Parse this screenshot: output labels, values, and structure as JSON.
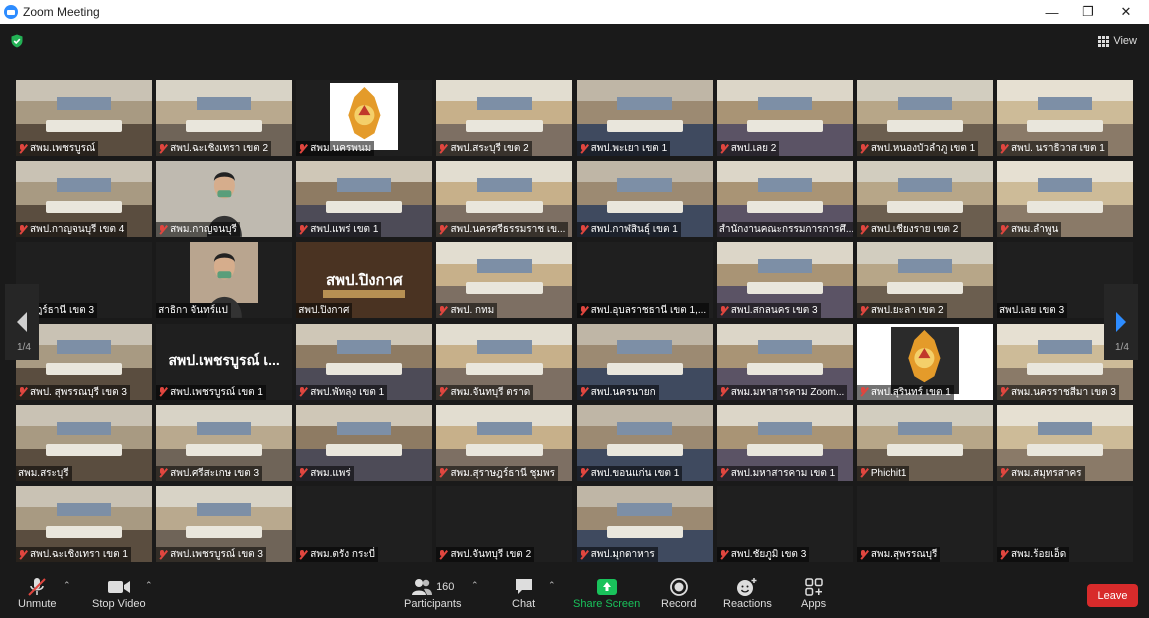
{
  "window": {
    "title": "Zoom Meeting",
    "controls": [
      "minimize",
      "maximize",
      "close"
    ]
  },
  "view_button": {
    "label": "View",
    "icon": "grid-icon"
  },
  "security_icon": "shield-check-icon",
  "pager": {
    "left_indicator": "1/4",
    "right_indicator": "1/4"
  },
  "tiles": [
    {
      "name": "สพม.เพชรบูรณ์",
      "muted": true,
      "scene": "room"
    },
    {
      "name": "สพป.ฉะเชิงเทรา เขต 2",
      "muted": true,
      "scene": "room"
    },
    {
      "name": "สพม.นครพนม",
      "muted": true,
      "scene": "seal"
    },
    {
      "name": "สพป.สระบุรี เขต 2",
      "muted": true,
      "scene": "room"
    },
    {
      "name": "สพป.พะเยา เขต 1",
      "muted": true,
      "scene": "room"
    },
    {
      "name": "สพป.เลย 2",
      "muted": true,
      "scene": "room"
    },
    {
      "name": "สพป.หนองบัวลำภู เขต 1",
      "muted": true,
      "scene": "room"
    },
    {
      "name": "สพป. นราธิวาส เขต 1",
      "muted": true,
      "scene": "room"
    },
    {
      "name": "สพป.กาญจนบุรี เขต 4",
      "muted": true,
      "scene": "room"
    },
    {
      "name": "สพม.กาญจนบุรี",
      "muted": true,
      "scene": "person"
    },
    {
      "name": "สพป.แพร่ เขต 1",
      "muted": true,
      "scene": "room"
    },
    {
      "name": "สพป.นครศรีธรรมราช เข...",
      "muted": true,
      "scene": "room"
    },
    {
      "name": "สพป.กาฬสินธุ์ เขต 1",
      "muted": true,
      "scene": "room"
    },
    {
      "name": "สำนักงานคณะกรรมการการศึ...",
      "muted": false,
      "scene": "room"
    },
    {
      "name": "สพป.เชียงราย เขต 2",
      "muted": true,
      "scene": "room"
    },
    {
      "name": "สพม.ลำพูน",
      "muted": true,
      "scene": "room"
    },
    {
      "name": "ราษฎร์ธานี เขต 3",
      "muted": false,
      "scene": "dark"
    },
    {
      "name": "สาธิกา จันทร์แป",
      "muted": false,
      "scene": "person"
    },
    {
      "name": "สพป.ปิงกาศ",
      "muted": false,
      "scene": "sign",
      "active": true,
      "sign_text": "สพป.ปิงกาศ"
    },
    {
      "name": "สพป. กทม",
      "muted": true,
      "scene": "room"
    },
    {
      "name": "สพป.อุบลราชธานี เขต 1,...",
      "muted": true,
      "scene": "dark"
    },
    {
      "name": "สพป.สกลนคร เขต 3",
      "muted": true,
      "scene": "room"
    },
    {
      "name": "สพป.ยะลา เขต 2",
      "muted": true,
      "scene": "room"
    },
    {
      "name": "สพป.เลย เขต 3",
      "muted": false,
      "scene": "dark"
    },
    {
      "name": "สพป. สุพรรณบุรี เขต 3",
      "muted": true,
      "scene": "room"
    },
    {
      "name": "สพป.เพชรบูรณ์ เขต 1",
      "muted": true,
      "scene": "textonly",
      "big_text": "สพป.เพชรบูรณ์ เ..."
    },
    {
      "name": "สพป.พัทลุง เขต 1",
      "muted": true,
      "scene": "room"
    },
    {
      "name": "สพม.จันทบุรี ตราด",
      "muted": true,
      "scene": "room"
    },
    {
      "name": "สพป.นครนายก",
      "muted": true,
      "scene": "room"
    },
    {
      "name": "สพม.มหาสารคาม Zoom...",
      "muted": true,
      "scene": "room"
    },
    {
      "name": "สพป.สุรินทร์ เขต 1",
      "muted": true,
      "scene": "seal"
    },
    {
      "name": "สพม.นครราชสีมา เขต 3",
      "muted": true,
      "scene": "room"
    },
    {
      "name": "สพม.สระบุรี",
      "muted": false,
      "scene": "room"
    },
    {
      "name": "สพป.ศรีสะเกษ เขต 3",
      "muted": true,
      "scene": "room"
    },
    {
      "name": "สพม.แพร่",
      "muted": true,
      "scene": "room"
    },
    {
      "name": "สพม.สุราษฎร์ธานี ชุมพร",
      "muted": true,
      "scene": "room"
    },
    {
      "name": "สพป.ขอนแก่น เขต 1",
      "muted": true,
      "scene": "room"
    },
    {
      "name": "สพป.มหาสารคาม เขต 1",
      "muted": true,
      "scene": "room"
    },
    {
      "name": "Phichit1",
      "muted": true,
      "scene": "room"
    },
    {
      "name": "สพม.สมุทรสาคร",
      "muted": true,
      "scene": "room"
    },
    {
      "name": "สพป.ฉะเชิงเทรา เขต 1",
      "muted": true,
      "scene": "room"
    },
    {
      "name": "สพป.เพชรบูรณ์ เขต 3",
      "muted": true,
      "scene": "room"
    },
    {
      "name": "สพม.ตรัง กระบี่",
      "muted": true,
      "scene": "dark"
    },
    {
      "name": "สพป.จันทบุรี เขต 2",
      "muted": true,
      "scene": "dark"
    },
    {
      "name": "สพป.มุกดาหาร",
      "muted": true,
      "scene": "room"
    },
    {
      "name": "สพป.ชัยภูมิ เขต 3",
      "muted": true,
      "scene": "dark"
    },
    {
      "name": "สพม.สุพรรณบุรี",
      "muted": true,
      "scene": "dark"
    },
    {
      "name": "สพม.ร้อยเอ็ด",
      "muted": true,
      "scene": "dark"
    }
  ],
  "toolbar": {
    "unmute": {
      "label": "Unmute",
      "icon": "mic-muted-icon"
    },
    "stop_video": {
      "label": "Stop Video",
      "icon": "video-camera-icon"
    },
    "participants": {
      "label": "Participants",
      "count": "160",
      "icon": "participants-icon"
    },
    "chat": {
      "label": "Chat",
      "icon": "chat-icon"
    },
    "share_screen": {
      "label": "Share Screen",
      "icon": "share-screen-icon",
      "color": "#19c25b"
    },
    "record": {
      "label": "Record",
      "icon": "record-icon"
    },
    "reactions": {
      "label": "Reactions",
      "icon": "reactions-icon"
    },
    "apps": {
      "label": "Apps",
      "icon": "apps-icon"
    },
    "leave": {
      "label": "Leave",
      "color": "#d82b2b"
    }
  }
}
